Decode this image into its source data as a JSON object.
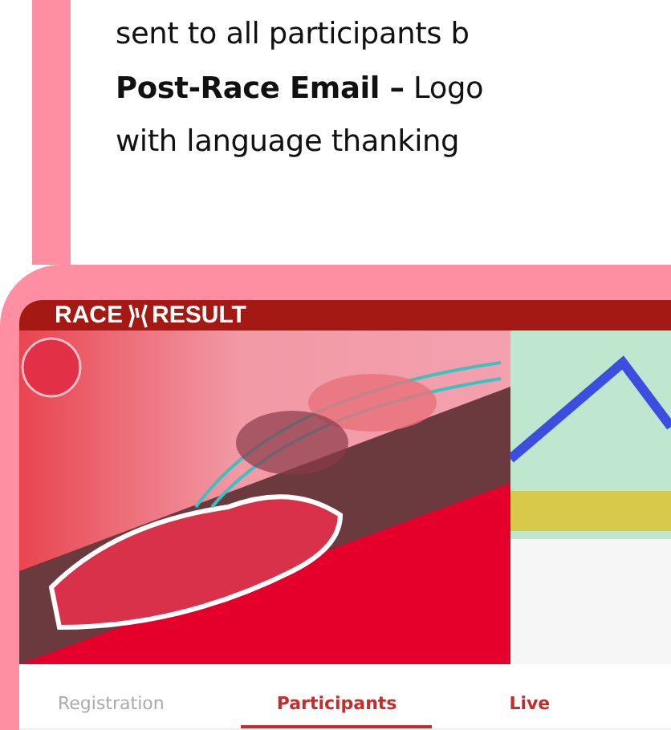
{
  "article": {
    "lines": [
      "sent to all participants b",
      "**Post-Race Email –** Logo",
      "with language thanking"
    ]
  },
  "app_screenshot": {
    "logo": {
      "left": "RACE",
      "right": "RESULT"
    },
    "tabs": [
      {
        "label": "Registration",
        "selected": false,
        "disabled": true
      },
      {
        "label": "Participants",
        "selected": true,
        "disabled": false
      },
      {
        "label": "Live",
        "selected": false,
        "disabled": false
      }
    ]
  }
}
